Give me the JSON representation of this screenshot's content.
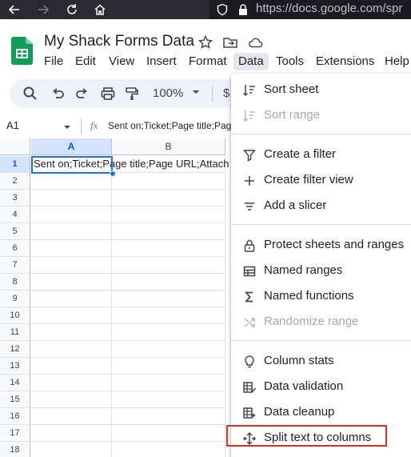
{
  "browser": {
    "url": "https://docs.google.com/spr"
  },
  "doc": {
    "title": "My Shack Forms Data"
  },
  "menubar": {
    "items": [
      "File",
      "Edit",
      "View",
      "Insert",
      "Format",
      "Data",
      "Tools",
      "Extensions",
      "Help"
    ],
    "active": "Data"
  },
  "toolbar": {
    "zoom": "100%",
    "currency": "$"
  },
  "formula_bar": {
    "cell_ref": "A1",
    "fx": "fx",
    "content": "Sent on;Ticket;Page title;Pag"
  },
  "grid": {
    "columns": [
      "A",
      "B"
    ],
    "rows": [
      "1",
      "2",
      "3",
      "4",
      "5",
      "6",
      "7",
      "8",
      "9",
      "10",
      "11",
      "12",
      "13",
      "14",
      "15",
      "16",
      "17",
      "18"
    ],
    "cell_a1": "Sent on;Ticket;Page title;Page URL;Attach"
  },
  "data_menu": {
    "sort_sheet": "Sort sheet",
    "sort_range": "Sort range",
    "create_filter": "Create a filter",
    "create_filter_view": "Create filter view",
    "add_slicer": "Add a slicer",
    "protect": "Protect sheets and ranges",
    "named_ranges": "Named ranges",
    "named_functions": "Named functions",
    "randomize_range": "Randomize range",
    "column_stats": "Column stats",
    "data_validation": "Data validation",
    "data_cleanup": "Data cleanup",
    "split_text": "Split text to columns"
  },
  "colors": {
    "accent": "#1a73e8",
    "highlight": "#d93025",
    "sheets_green": "#0f9d58"
  }
}
